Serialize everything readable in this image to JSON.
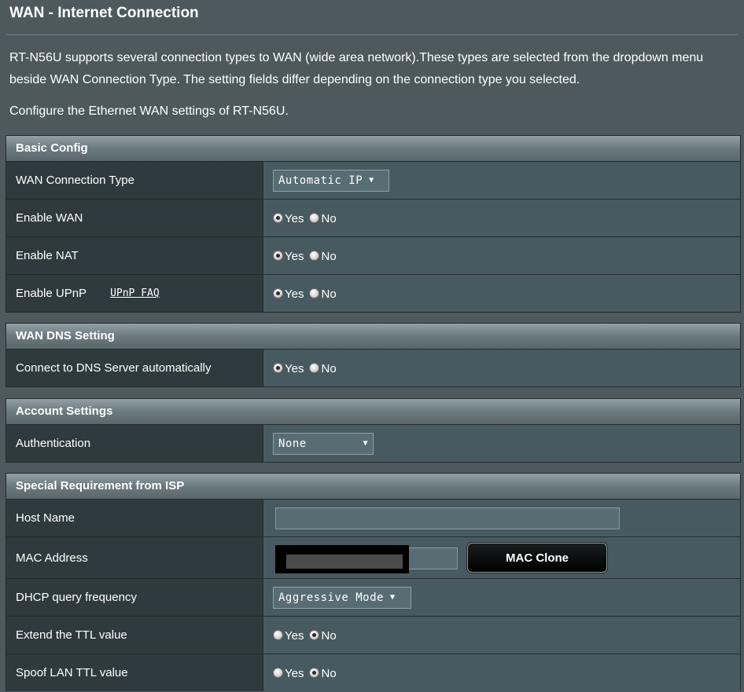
{
  "page": {
    "title": "WAN - Internet Connection",
    "description": "RT-N56U supports several connection types to WAN (wide area network).These types are selected from the dropdown menu beside WAN Connection Type. The setting fields differ depending on the connection type you selected.",
    "configure_text": "Configure the Ethernet WAN settings of RT-N56U."
  },
  "radio_labels": {
    "yes": "Yes",
    "no": "No"
  },
  "basic_config": {
    "heading": "Basic Config",
    "wan_type_label": "WAN Connection Type",
    "wan_type_value": "Automatic IP",
    "enable_wan_label": "Enable WAN",
    "enable_wan": "Yes",
    "enable_nat_label": "Enable NAT",
    "enable_nat": "Yes",
    "enable_upnp_label": "Enable UPnP",
    "upnp_faq_link": "UPnP FAQ",
    "enable_upnp": "Yes"
  },
  "wan_dns": {
    "heading": "WAN DNS Setting",
    "dns_auto_label": "Connect to DNS Server automatically",
    "dns_auto": "Yes"
  },
  "account": {
    "heading": "Account Settings",
    "auth_label": "Authentication",
    "auth_value": "None"
  },
  "isp": {
    "heading": "Special Requirement from ISP",
    "host_name_label": "Host Name",
    "host_name_value": "",
    "mac_label": "MAC Address",
    "mac_clone_button": "MAC Clone",
    "dhcp_label": "DHCP query frequency",
    "dhcp_value": "Aggressive Mode",
    "ttl_extend_label": "Extend the TTL value",
    "ttl_extend": "No",
    "spoof_ttl_label": "Spoof LAN TTL value",
    "spoof_ttl": "No"
  },
  "icons": {
    "dropdown": "chevron-down-icon",
    "radio": "radio-icon"
  },
  "colors": {
    "background": "#4d595d",
    "label_cell": "#2f3a3e",
    "value_cell": "#475a5f",
    "section_header": "#6b7a7e",
    "button": "#000000"
  }
}
